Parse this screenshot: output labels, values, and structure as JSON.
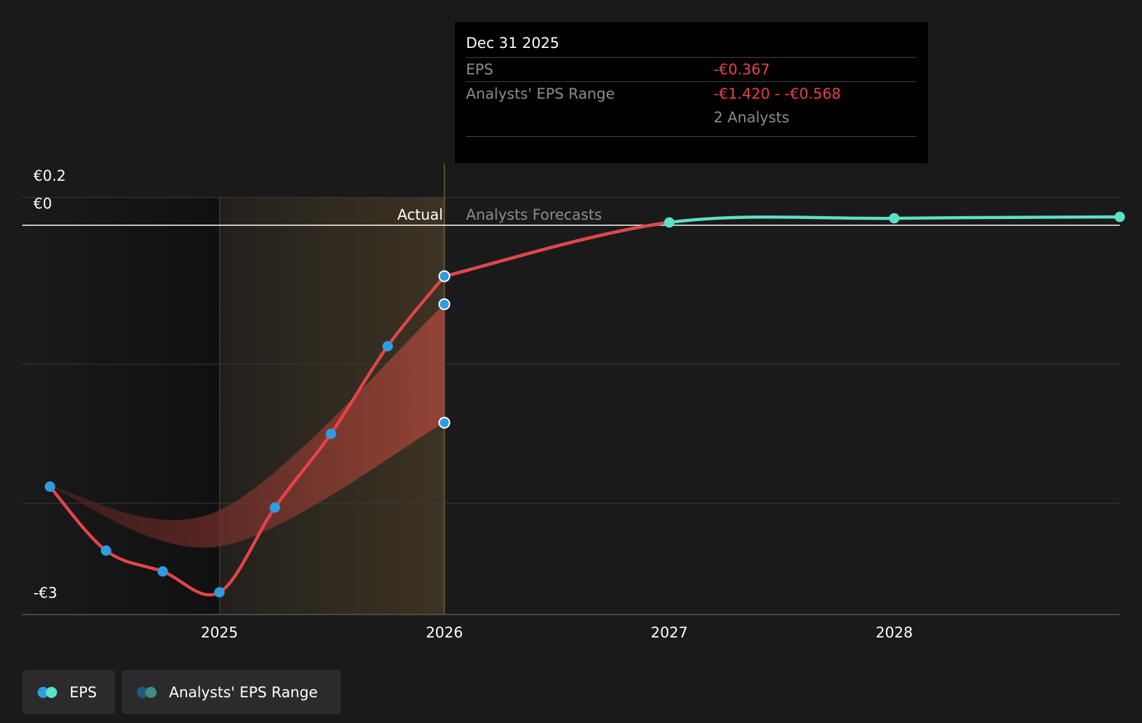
{
  "tooltip": {
    "date": "Dec 31 2025",
    "eps_label": "EPS",
    "eps_value": "-€0.367",
    "range_label": "Analysts' EPS Range",
    "range_low": "-€1.420",
    "range_sep": " - ",
    "range_high": "-€0.568",
    "analysts": "2 Analysts"
  },
  "sections": {
    "actual": "Actual",
    "forecast": "Analysts Forecasts"
  },
  "legend": {
    "eps": "EPS",
    "range": "Analysts' EPS Range"
  },
  "colors": {
    "background": "#1a1a1a",
    "eps_line": "#e5434a",
    "eps_forecast_line": "#5ce0c6",
    "eps_point": "#2f9be0",
    "range_fill": "#a9473a",
    "actual_highlight": "#3d3323"
  },
  "chart_data": {
    "type": "line",
    "y_tick_labels": [
      "€0.2",
      "€0",
      "-€3"
    ],
    "yticks": [
      0.2,
      0,
      -3
    ],
    "ylim": [
      -2.8,
      0.2
    ],
    "x_tick_labels": [
      "2025",
      "2026",
      "2027",
      "2028"
    ],
    "xlim": [
      "2024-02-15",
      "2028-12-31"
    ],
    "grid": true,
    "legend_position": "bottom-left",
    "forecast_start": "2025-12-31",
    "series": [
      {
        "name": "EPS",
        "segment": "actual",
        "points": [
          {
            "x": "2024-03-31",
            "y": -1.88
          },
          {
            "x": "2024-06-30",
            "y": -2.34
          },
          {
            "x": "2024-09-30",
            "y": -2.49
          },
          {
            "x": "2024-12-31",
            "y": -2.64
          },
          {
            "x": "2025-03-31",
            "y": -2.03
          },
          {
            "x": "2025-06-30",
            "y": -1.5
          },
          {
            "x": "2025-09-30",
            "y": -0.87
          },
          {
            "x": "2025-12-31",
            "y": -0.367
          }
        ]
      },
      {
        "name": "EPS",
        "segment": "forecast",
        "points": [
          {
            "x": "2025-12-31",
            "y": -0.367
          },
          {
            "x": "2026-12-31",
            "y": 0.02
          },
          {
            "x": "2027-12-31",
            "y": 0.05
          },
          {
            "x": "2028-12-31",
            "y": 0.06
          }
        ]
      },
      {
        "name": "Analysts' EPS Range",
        "type": "range",
        "points": [
          {
            "x": "2024-03-31",
            "low": -1.88,
            "high": -1.88
          },
          {
            "x": "2024-12-31",
            "low": -2.31,
            "high": -2.05
          },
          {
            "x": "2025-12-31",
            "low": -1.42,
            "high": -0.568
          }
        ]
      }
    ]
  }
}
